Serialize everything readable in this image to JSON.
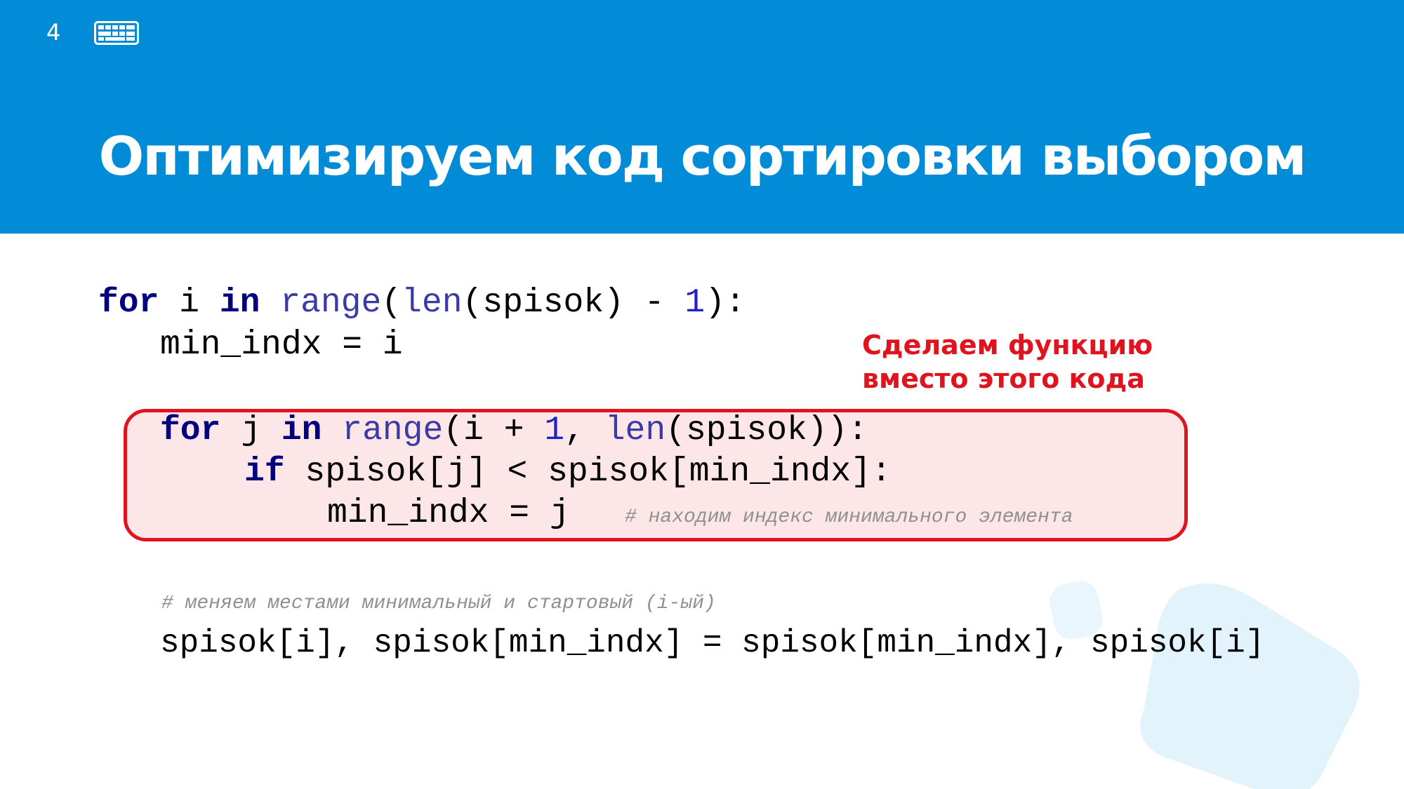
{
  "slide": {
    "number": "4",
    "title": "Оптимизируем код сортировки выбором"
  },
  "colors": {
    "header_bg": "#028bd6",
    "highlight_border": "#e0141e",
    "highlight_bg": "#fde6e8",
    "keyword": "#000080",
    "comment": "#909090"
  },
  "code": {
    "line1": {
      "kw1": "for",
      "t1": " i ",
      "kw2": "in",
      "t2": " ",
      "fn1": "range",
      "t3": "(",
      "fn2": "len",
      "t4": "(spisok) - ",
      "num1": "1",
      "t5": "):"
    },
    "line2": {
      "t1": "min_indx = i"
    },
    "line3": {
      "kw1": "for",
      "t1": " j ",
      "kw2": "in",
      "t2": " ",
      "fn1": "range",
      "t3": "(i + ",
      "num1": "1",
      "t4": ", ",
      "fn2": "len",
      "t5": "(spisok)):"
    },
    "line4": {
      "kw1": "if",
      "t1": " spisok[j] < spisok[min_indx]:"
    },
    "line5": {
      "t1": "min_indx = j",
      "comment": "# находим индекс минимального элемента"
    },
    "comment_swap": "# меняем местами минимальный и стартовый (i-ый)",
    "line6": {
      "t1": "spisok[i], spisok[min_indx] = spisok[min_indx], spisok[i]"
    }
  },
  "note": {
    "line1": "Сделаем функцию",
    "line2": "вместо этого кода"
  }
}
